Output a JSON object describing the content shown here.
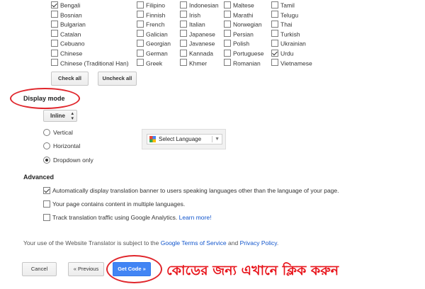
{
  "languages": {
    "col1": [
      {
        "label": "Bengali",
        "checked": true
      },
      {
        "label": "Bosnian",
        "checked": false
      },
      {
        "label": "Bulgarian",
        "checked": false
      },
      {
        "label": "Catalan",
        "checked": false
      },
      {
        "label": "Cebuano",
        "checked": false
      },
      {
        "label": "Chinese",
        "checked": false
      },
      {
        "label": "Chinese (Traditional Han)",
        "checked": false
      }
    ],
    "col2": [
      {
        "label": "Filipino",
        "checked": false
      },
      {
        "label": "Finnish",
        "checked": false
      },
      {
        "label": "French",
        "checked": false
      },
      {
        "label": "Galician",
        "checked": false
      },
      {
        "label": "Georgian",
        "checked": false
      },
      {
        "label": "German",
        "checked": false
      },
      {
        "label": "Greek",
        "checked": false
      }
    ],
    "col3": [
      {
        "label": "Indonesian",
        "checked": false
      },
      {
        "label": "Irish",
        "checked": false
      },
      {
        "label": "Italian",
        "checked": false
      },
      {
        "label": "Japanese",
        "checked": false
      },
      {
        "label": "Javanese",
        "checked": false
      },
      {
        "label": "Kannada",
        "checked": false
      },
      {
        "label": "Khmer",
        "checked": false
      }
    ],
    "col4": [
      {
        "label": "Maltese",
        "checked": false
      },
      {
        "label": "Marathi",
        "checked": false
      },
      {
        "label": "Norwegian",
        "checked": false
      },
      {
        "label": "Persian",
        "checked": false
      },
      {
        "label": "Polish",
        "checked": false
      },
      {
        "label": "Portuguese",
        "checked": false
      },
      {
        "label": "Romanian",
        "checked": false
      }
    ],
    "col5": [
      {
        "label": "Tamil",
        "checked": false
      },
      {
        "label": "Telugu",
        "checked": false
      },
      {
        "label": "Thai",
        "checked": false
      },
      {
        "label": "Turkish",
        "checked": false
      },
      {
        "label": "Ukrainian",
        "checked": false
      },
      {
        "label": "Urdu",
        "checked": true
      },
      {
        "label": "Vietnamese",
        "checked": false
      }
    ]
  },
  "buttons": {
    "check_all": "Check all",
    "uncheck_all": "Uncheck all",
    "cancel": "Cancel",
    "previous": "« Previous",
    "get_code": "Get Code »"
  },
  "display_mode": {
    "title": "Display mode",
    "select_value": "Inline",
    "options": [
      {
        "label": "Vertical",
        "selected": false
      },
      {
        "label": "Horizontal",
        "selected": false
      },
      {
        "label": "Dropdown only",
        "selected": true
      }
    ],
    "preview_label": "Select Language"
  },
  "advanced": {
    "title": "Advanced",
    "options": [
      {
        "label": "Automatically display translation banner to users speaking languages other than the language of your page.",
        "checked": true,
        "link": ""
      },
      {
        "label": "Your page contains content in multiple languages.",
        "checked": false,
        "link": ""
      },
      {
        "label": "Track translation traffic using Google Analytics.",
        "checked": false,
        "link": "Learn more!"
      }
    ]
  },
  "terms": {
    "prefix": "Your use of the Website Translator is subject to the",
    "tos_link": "Google Terms of Service",
    "and": "and",
    "privacy_link": "Privacy Policy",
    "suffix": "."
  },
  "annotation": {
    "text": "কোডের জন্য এখানে ক্লিক করুন",
    "color": "#e8161d"
  },
  "colors": {
    "primary_button": "#4285f4",
    "link": "#1155cc",
    "annotation_red": "#e0262c"
  }
}
